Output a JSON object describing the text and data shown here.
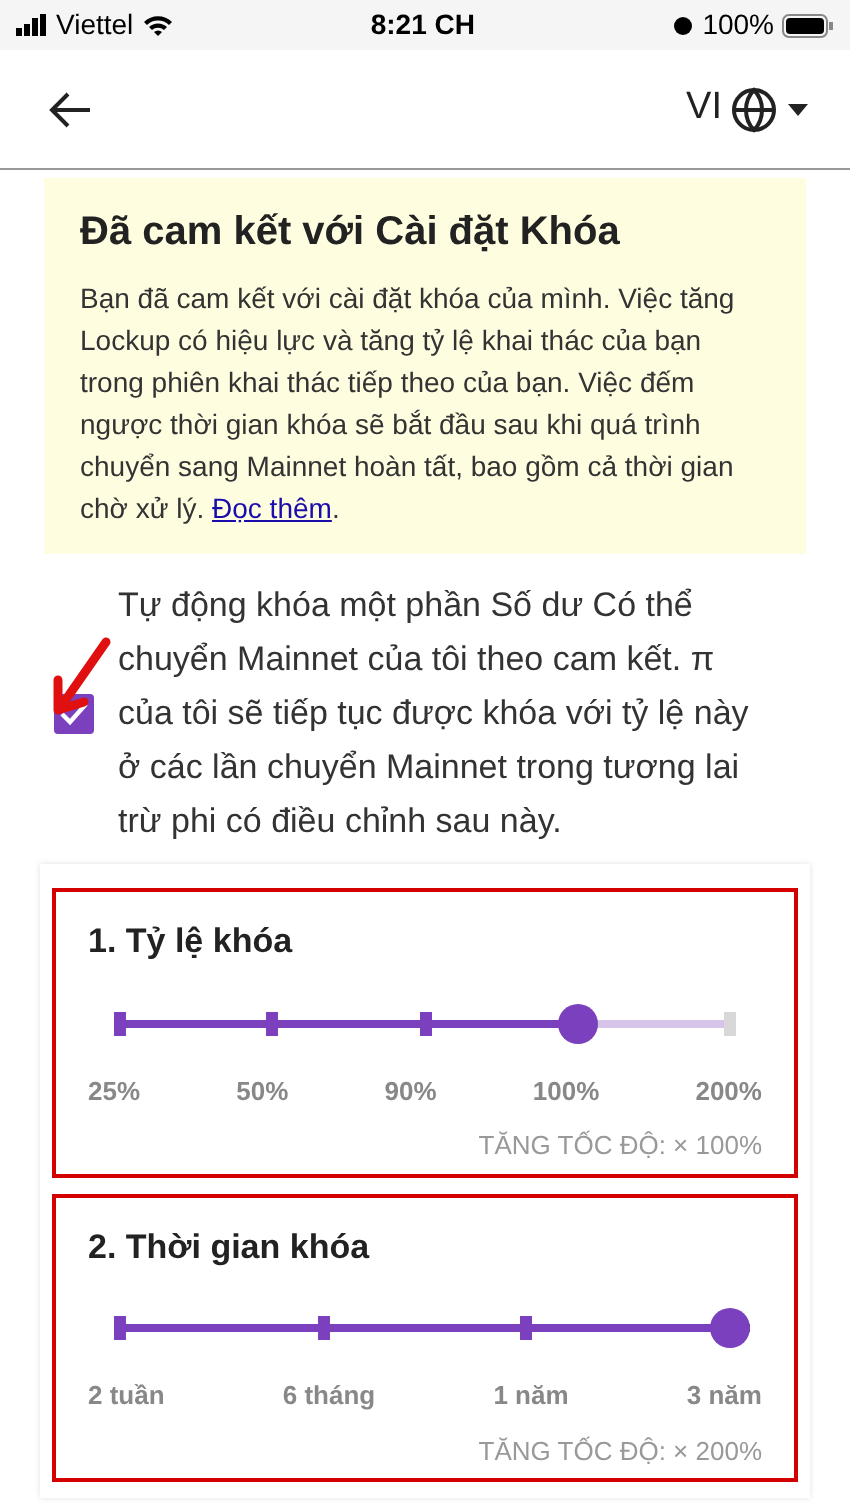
{
  "status_bar": {
    "carrier": "Viettel",
    "time": "8:21 CH",
    "battery": "100%"
  },
  "header": {
    "language": "VI"
  },
  "notice": {
    "title": "Đã cam kết với Cài đặt Khóa",
    "body": "Bạn đã cam kết với cài đặt khóa của mình. Việc tăng Lockup có hiệu lực và tăng tỷ lệ khai thác của bạn trong phiên khai thác tiếp theo của bạn. Việc đếm ngược thời gian khóa sẽ bắt đầu sau khi quá trình chuyển sang Mainnet hoàn tất, bao gồm cả thời gian chờ xử lý.",
    "link": "Đọc thêm",
    "after_link": "."
  },
  "auto_lock": {
    "checked": true,
    "label": "Tự động khóa một phần Số dư Có thể chuyển Mainnet của tôi theo cam kết. π của tôi sẽ tiếp tục được khóa với tỷ lệ này ở các lần chuyển Mainnet trong tương lai trừ phi có điều chỉnh sau này."
  },
  "sliders": [
    {
      "title": "1. Tỷ lệ khóa",
      "level": 0.75,
      "stops": [
        "25%",
        "50%",
        "90%",
        "100%",
        "200%"
      ],
      "boost": "TĂNG TỐC ĐỘ: × 100%"
    },
    {
      "title": "2. Thời gian khóa",
      "level": 1,
      "stops": [
        "2 tuần",
        "6 tháng",
        "1 năm",
        "3 năm"
      ],
      "boost": "TĂNG TỐC ĐỘ: × 200%"
    }
  ]
}
